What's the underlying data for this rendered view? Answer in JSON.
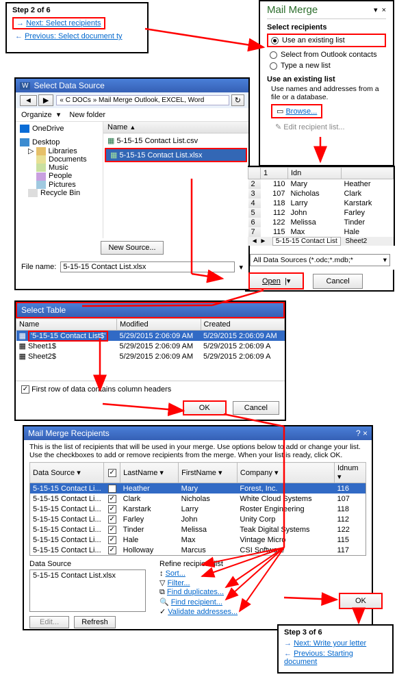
{
  "step2": {
    "title": "Step 2 of 6",
    "next": "Next: Select recipients",
    "prev": "Previous: Select document ty"
  },
  "mailmerge": {
    "title": "Mail Merge",
    "section1": "Select recipients",
    "opt_existing": "Use an existing list",
    "opt_outlook": "Select from Outlook contacts",
    "opt_new": "Type a new list",
    "section2": "Use an existing list",
    "help": "Use names and addresses from a file or a database.",
    "browse": "Browse...",
    "edit": "Edit recipient list..."
  },
  "datasource": {
    "title": "Select Data Source",
    "breadcrumb": "« C DOCs » Mail Merge Outlook, EXCEL, Word",
    "organize": "Organize",
    "newfolder": "New folder",
    "col_name": "Name",
    "tree": [
      "OneDrive",
      "Desktop",
      "Libraries",
      "Documents",
      "Music",
      "People",
      "Pictures",
      "Recycle Bin"
    ],
    "file_csv": "5-15-15 Contact List.csv",
    "file_xlsx": "5-15-15 Contact List.xlsx",
    "newsource": "New Source...",
    "filename_label": "File name:",
    "filename_value": "5-15-15 Contact List.xlsx",
    "filter": "All Data Sources (*.odc;*.mdb;*",
    "open": "Open",
    "cancel": "Cancel"
  },
  "excel_preview": {
    "headers": [
      "Idn"
    ],
    "rows": [
      [
        "110",
        "Mary",
        "Heather"
      ],
      [
        "107",
        "Nicholas",
        "Clark"
      ],
      [
        "118",
        "Larry",
        "Karstark"
      ],
      [
        "112",
        "John",
        "Farley"
      ],
      [
        "122",
        "Melissa",
        "Tinder"
      ],
      [
        "115",
        "Max",
        "Hale"
      ]
    ],
    "tabs": [
      "5-15-15 Contact List",
      "Sheet2"
    ]
  },
  "selecttable": {
    "title": "Select Table",
    "cols": [
      "Name",
      "Modified",
      "Created"
    ],
    "rows": [
      [
        "'5-15-15 Contact List$'",
        "5/29/2015 2:06:09 AM",
        "5/29/2015 2:06:09 AM"
      ],
      [
        "Sheet1$",
        "5/29/2015 2:06:09 AM",
        "5/29/2015 2:06:09 A"
      ],
      [
        "Sheet2$",
        "5/29/2015 2:06:09 AM",
        "5/29/2015 2:06:09 A"
      ]
    ],
    "firstrow": "First row of data contains column headers",
    "ok": "OK",
    "cancel": "Cancel"
  },
  "recipients": {
    "title": "Mail Merge Recipients",
    "desc": "This is the list of recipients that will be used in your merge. Use options below to add or change your list. Use the checkboxes to add or remove recipients from the merge.  When your list is ready, click OK.",
    "cols": [
      "Data Source",
      "",
      "LastName",
      "FirstName",
      "Company",
      "Idnum"
    ],
    "rows": [
      [
        "5-15-15 Contact Li...",
        "Heather",
        "Mary",
        "Forest, Inc.",
        "116"
      ],
      [
        "5-15-15 Contact Li...",
        "Clark",
        "Nicholas",
        "White Cloud Systems",
        "107"
      ],
      [
        "5-15-15 Contact Li...",
        "Karstark",
        "Larry",
        "Roster Engineering",
        "118"
      ],
      [
        "5-15-15 Contact Li...",
        "Farley",
        "John",
        "Unity Corp",
        "112"
      ],
      [
        "5-15-15 Contact Li...",
        "Tinder",
        "Melissa",
        "Teak Digital Systems",
        "122"
      ],
      [
        "5-15-15 Contact Li...",
        "Hale",
        "Max",
        "Vintage Micro",
        "115"
      ],
      [
        "5-15-15 Contact Li...",
        "Holloway",
        "Marcus",
        "CSI Software",
        "117"
      ]
    ],
    "ds_section": "Data Source",
    "ds_file": "5-15-15 Contact List.xlsx",
    "refine_section": "Refine recipient list",
    "sort": "Sort...",
    "filter": "Filter...",
    "dup": "Find duplicates...",
    "find": "Find recipient...",
    "validate": "Validate addresses...",
    "edit": "Edit...",
    "refresh": "Refresh",
    "ok": "OK"
  },
  "step3": {
    "title": "Step 3 of 6",
    "next": "Next: Write your letter",
    "prev": "Previous: Starting document"
  }
}
